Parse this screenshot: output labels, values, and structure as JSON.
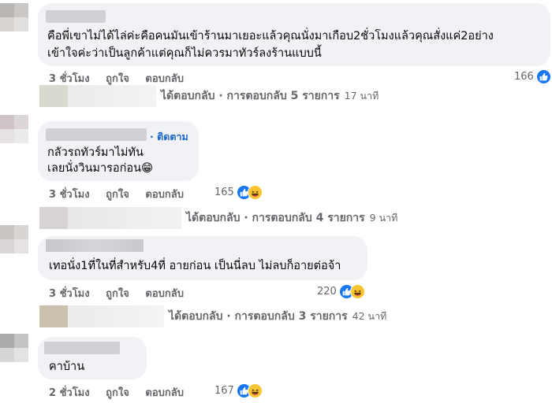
{
  "comments": [
    {
      "body_lines": [
        "คือพี่เขาไม่ได้ไล่ค่ะคือคนมันเข้าร้านมาเยอะแล้วคุณนั่งมาเกือบ2ชั่วโมงแล้วคุณสั่งแค่2อย่าง",
        "เข้าใจค่ะว่าเป็นลูกค้าแต่คุณก็ไม่ควรมาทัวร์ลงร้านแบบนี้"
      ],
      "time": "3 ชั่วโมง",
      "like": "ถูกใจ",
      "reply": "ตอบกลับ",
      "reaction_count": "166",
      "reactions": [
        "like-icon"
      ]
    },
    {
      "follow": "· ติดตาม",
      "body_lines": [
        "กลัวรถทัวร์มาไม่ทัน",
        "เลยนั่งวินมารอก่อน😁"
      ],
      "time": "3 ชั่วโมง",
      "like": "ถูกใจ",
      "reply": "ตอบกลับ",
      "reaction_count": "165",
      "reactions": [
        "like-icon",
        "haha-icon"
      ]
    },
    {
      "body_lines": [
        "เทอนั่ง1ที่ในที่สำหรับ4ที่ อายก่อน เป็นนี่ลบ ไม่ลบก็อายต่อจ้า"
      ],
      "time": "3 ชั่วโมง",
      "like": "ถูกใจ",
      "reply": "ตอบกลับ",
      "reaction_count": "220",
      "reactions": [
        "like-icon",
        "haha-icon"
      ]
    },
    {
      "body_lines": [
        "คาบ้าน"
      ],
      "time": "2 ชั่วโมง",
      "like": "ถูกใจ",
      "reply": "ตอบกลับ",
      "reaction_count": "167",
      "reactions": [
        "like-icon",
        "haha-icon"
      ]
    }
  ],
  "reply_rows": [
    {
      "text": "ได้ตอบกลับ · การตอบกลับ 5 รายการ",
      "time": "17 นาที"
    },
    {
      "text": "ได้ตอบกลับ · การตอบกลับ 4 รายการ",
      "time": "9 นาที"
    },
    {
      "text": "ได้ตอบกลับ · การตอบกลับ 3 รายการ",
      "time": "42 นาที"
    }
  ],
  "colors": {
    "accent": "#1877f2",
    "haha": "#f7c531",
    "bubble": "#f0f2f5",
    "muted": "#65676b"
  }
}
